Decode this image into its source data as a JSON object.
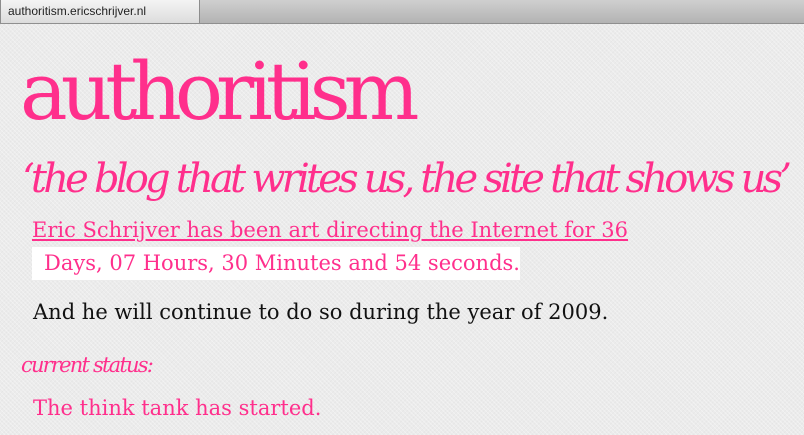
{
  "browser": {
    "tab_title": "authoritism.ericschrijver.nl"
  },
  "site": {
    "title": "authoritism",
    "tagline": "‘the blog that writes us, the site that shows us’"
  },
  "counter": {
    "line1": "Eric Schrijver has been art directing the Internet for 36",
    "line2": "Days, 07 Hours, 30 Minutes and 54 seconds."
  },
  "continuation": "And he will continue to do so during the year of 2009.",
  "status": {
    "heading": "current status:",
    "text": "The think tank has started."
  },
  "colors": {
    "accent": "#ff2f8c",
    "text": "#111111",
    "background": "#ebebeb"
  }
}
